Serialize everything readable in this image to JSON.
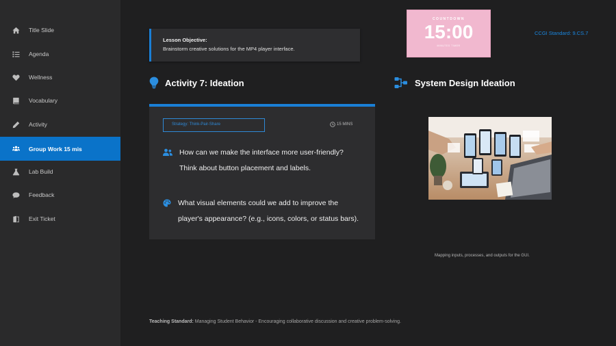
{
  "sidebar": {
    "items": [
      {
        "label": "Title Slide",
        "icon": "home-icon"
      },
      {
        "label": "Agenda",
        "icon": "list-icon"
      },
      {
        "label": "Wellness",
        "icon": "heart-icon"
      },
      {
        "label": "Vocabulary",
        "icon": "book-icon"
      },
      {
        "label": "Activity",
        "icon": "pencil-icon"
      },
      {
        "label": "Group Work 15 mis",
        "icon": "users-icon",
        "active": true
      },
      {
        "label": "Lab Build",
        "icon": "flask-icon"
      },
      {
        "label": "Feedback",
        "icon": "comment-icon"
      },
      {
        "label": "Exit Ticket",
        "icon": "door-icon"
      }
    ]
  },
  "objective": {
    "title": "Lesson Objective:",
    "text": "Brainstorm creative solutions for the MP4 player interface."
  },
  "countdown": {
    "label": "COUNTDOWN",
    "value": "15:00",
    "sublabel": "MINUTES TIMER"
  },
  "standard": "CCGI Standard: 9.CS.7",
  "activity": {
    "title": "Activity 7: Ideation",
    "strategy": "Strategy: Think-Pair-Share",
    "duration": "15 MINS",
    "question1_line1": "How can we make the interface more user-friendly?",
    "question1_line2": "Think about button placement and labels.",
    "question2_line1": "What visual elements could we add to improve the",
    "question2_line2": "player's appearance? (e.g., icons, colors, or status bars)."
  },
  "system": {
    "title": "System Design Ideation",
    "caption": "Mapping inputs, processes, and outputs for the GUI."
  },
  "teaching": {
    "label": "Teaching Standard:",
    "text": " Managing Student Behavior - Encouraging collaborative discussion and creative problem-solving."
  },
  "colors": {
    "accent": "#1a7fd6",
    "active_nav": "#0a73c9",
    "background": "#1f1f20",
    "sidebar": "#2a2a2b",
    "countdown_bg": "#f1b8cf"
  }
}
